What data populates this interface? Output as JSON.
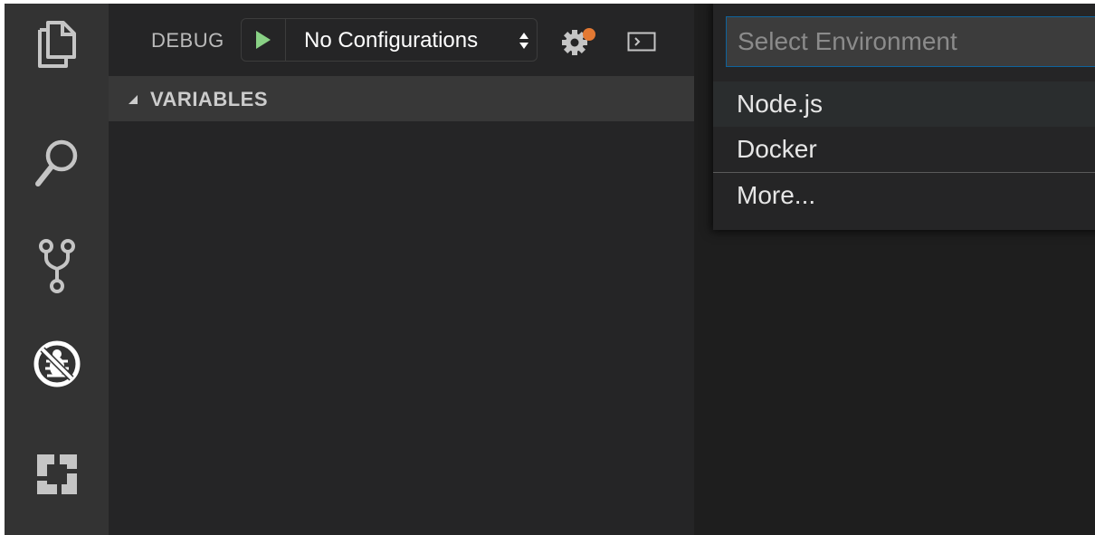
{
  "colors": {
    "activity_bar": "#333333",
    "sidebar": "#252526",
    "section_header": "#383838",
    "editor": "#1e1e1e",
    "play_green": "#89d185",
    "badge_orange": "#e37933",
    "focus_border": "#0e639c"
  },
  "activity_bar": {
    "items": [
      {
        "icon": "files-icon"
      },
      {
        "icon": "search-icon"
      },
      {
        "icon": "source-control-icon"
      },
      {
        "icon": "debug-icon",
        "active": true
      },
      {
        "icon": "extensions-icon"
      }
    ]
  },
  "debug": {
    "title": "DEBUG",
    "play_icon": "play-icon",
    "configuration": "No Configurations",
    "gear_icon": "gear-icon",
    "console_icon": "console-icon"
  },
  "variables": {
    "title": "VARIABLES"
  },
  "quick_pick": {
    "placeholder": "Select Environment",
    "items": [
      {
        "label": "Node.js",
        "selected": true
      },
      {
        "label": "Docker"
      },
      {
        "label": "More...",
        "separator_above": true
      }
    ]
  }
}
